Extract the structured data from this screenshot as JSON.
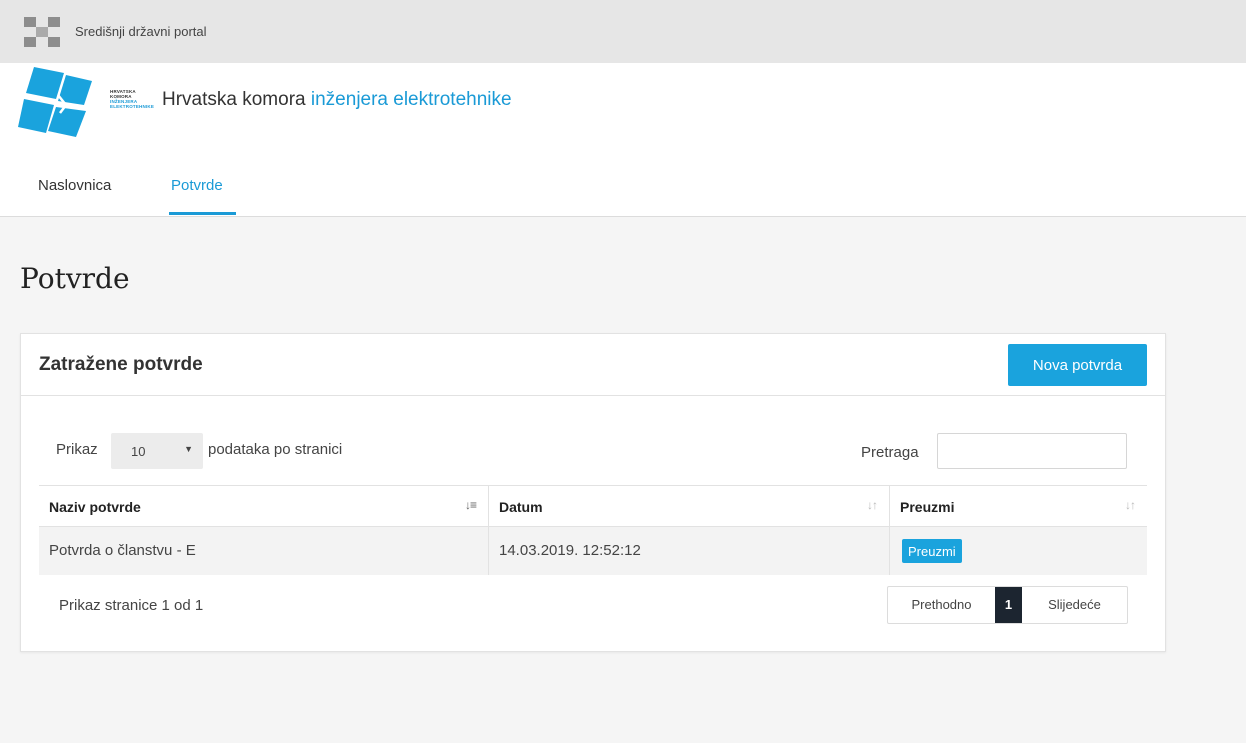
{
  "portal": {
    "title": "Središnji državni portal"
  },
  "org": {
    "logo_text": [
      "HRVATSKA",
      "KOMORA",
      "INŽENJERA",
      "ELEKTROTEHNIKE"
    ],
    "title_prefix": "Hrvatska komora",
    "title_accent": "inženjera elektrotehnike"
  },
  "nav": {
    "items": [
      {
        "label": "Naslovnica",
        "active": false
      },
      {
        "label": "Potvrde",
        "active": true
      }
    ]
  },
  "page": {
    "title": "Potvrde"
  },
  "card": {
    "title": "Zatražene potvrde",
    "new_button": "Nova potvrda",
    "length": {
      "prefix": "Prikaz",
      "value": "10",
      "suffix": "podataka po stranici"
    },
    "search_label": "Pretraga",
    "search_value": "",
    "columns": [
      "Naziv potvrde",
      "Datum",
      "Preuzmi"
    ],
    "rows": [
      {
        "name": "Potvrda o članstvu - E",
        "date": "14.03.2019. 12:52:12",
        "action": "Preuzmi"
      }
    ],
    "info": "Prikaz stranice 1 od 1",
    "pagination": {
      "prev": "Prethodno",
      "current": "1",
      "next": "Slijedeće"
    }
  },
  "colors": {
    "accent": "#1aa3dd",
    "brand_blue": "#1a9ad6",
    "page_active": "#1c2530"
  }
}
